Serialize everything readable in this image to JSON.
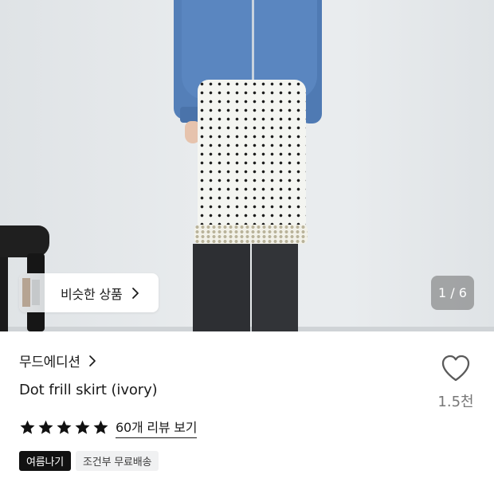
{
  "gallery": {
    "similar_label": "비슷한 상품",
    "counter": "1 / 6"
  },
  "product": {
    "brand": "무드에디션",
    "title": "Dot frill skirt (ivory)",
    "rating_stars": 5,
    "review_link": "60개 리뷰 보기",
    "tags": [
      "여름나기",
      "조건부 무료배송"
    ],
    "like_count": "1.5천"
  },
  "icons": {
    "chevron": "chevron-right-icon",
    "heart": "heart-outline-icon",
    "star": "star-filled-icon"
  },
  "colors": {
    "tag_dark_bg": "#111111",
    "tag_light_bg": "#f0f1f2",
    "like_count": "#777777"
  }
}
